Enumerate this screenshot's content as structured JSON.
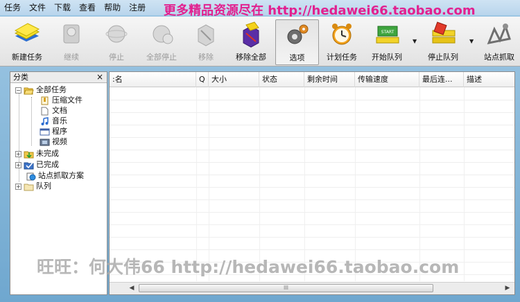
{
  "menu": {
    "items": [
      "任务",
      "文件",
      "下载",
      "查看",
      "帮助",
      "注册"
    ]
  },
  "promo_text": "更多精品资源尽在 http://hedawei66.taobao.com",
  "toolbar": {
    "buttons": [
      {
        "label": "新建任务",
        "icon": "new-task-icon",
        "enabled": true
      },
      {
        "label": "继续",
        "icon": "resume-icon",
        "enabled": false
      },
      {
        "label": "停止",
        "icon": "stop-icon",
        "enabled": false
      },
      {
        "label": "全部停止",
        "icon": "stop-all-icon",
        "enabled": false
      },
      {
        "label": "移除",
        "icon": "remove-icon",
        "enabled": false
      },
      {
        "label": "移除全部",
        "icon": "remove-all-icon",
        "enabled": true
      },
      {
        "label": "选项",
        "icon": "options-gear-icon",
        "enabled": true
      },
      {
        "label": "计划任务",
        "icon": "alarm-clock-icon",
        "enabled": true
      },
      {
        "label": "开始队列",
        "icon": "start-queue-icon",
        "enabled": true
      },
      {
        "label": "停止队列",
        "icon": "stop-queue-icon",
        "enabled": true
      },
      {
        "label": "站点抓取",
        "icon": "site-grabber-icon",
        "enabled": true
      }
    ]
  },
  "tree": {
    "header": "分类",
    "close": "×",
    "nodes": [
      {
        "label": "全部任务",
        "icon": "open-folder-icon"
      },
      {
        "label": "压缩文件",
        "icon": "zip-file-icon"
      },
      {
        "label": "文档",
        "icon": "document-icon"
      },
      {
        "label": "音乐",
        "icon": "music-note-icon"
      },
      {
        "label": "程序",
        "icon": "program-window-icon"
      },
      {
        "label": "视频",
        "icon": "video-film-icon"
      },
      {
        "label": "未完成",
        "icon": "unfinished-folder-icon"
      },
      {
        "label": "已完成",
        "icon": "finished-folder-icon"
      },
      {
        "label": "站点抓取方案",
        "icon": "site-grab-scheme-icon"
      },
      {
        "label": "队列",
        "icon": "queue-folder-icon"
      }
    ]
  },
  "grid": {
    "columns": [
      ":名",
      "Q",
      "大小",
      "状态",
      "剩余时间",
      "传输速度",
      "最后连...",
      "描述"
    ]
  },
  "scroll_grip": "III",
  "watermark": "旺旺：何大伟66  http://hedawei66.taobao.com",
  "colors": {
    "promo": "#e2208f",
    "frame": "#6fa7cf"
  }
}
